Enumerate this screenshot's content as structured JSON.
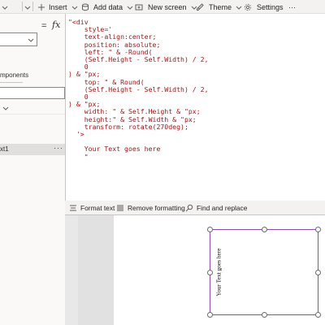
{
  "toolbar": {
    "insert_label": "Insert",
    "add_data_label": "Add data",
    "new_screen_label": "New screen",
    "theme_label": "Theme",
    "settings_label": "Settings",
    "more_label": "···"
  },
  "formula_bar": {
    "equals": "=",
    "fx": "fx"
  },
  "left_panel": {
    "components_label": "mponents",
    "tree_item_label": "xt1",
    "tree_item_more": "···"
  },
  "editor": {
    "code": "\"<div\n    style='\n    text-align:center;\n    position: absolute;\n    left: \" & -Round(\n    (Self.Height - Self.Width) / 2,\n    0\n) & \"px;\n    top: \" & Round(\n    (Self.Height - Self.Width) / 2,\n    0\n) & \"px;\n    width: \" & Self.Height & \"px;\n    height:\" & Self.Width & \"px;\n    transform: rotate(270deg);\n  '>\n\n    Your Text goes here\n    \""
  },
  "editor_bar": {
    "format_text_label": "Format text",
    "remove_formatting_label": "Remove formatting",
    "find_replace_label": "Find and replace"
  },
  "canvas": {
    "rotated_text": "Your Text goes here",
    "selection_color": "#8f4bb3"
  }
}
